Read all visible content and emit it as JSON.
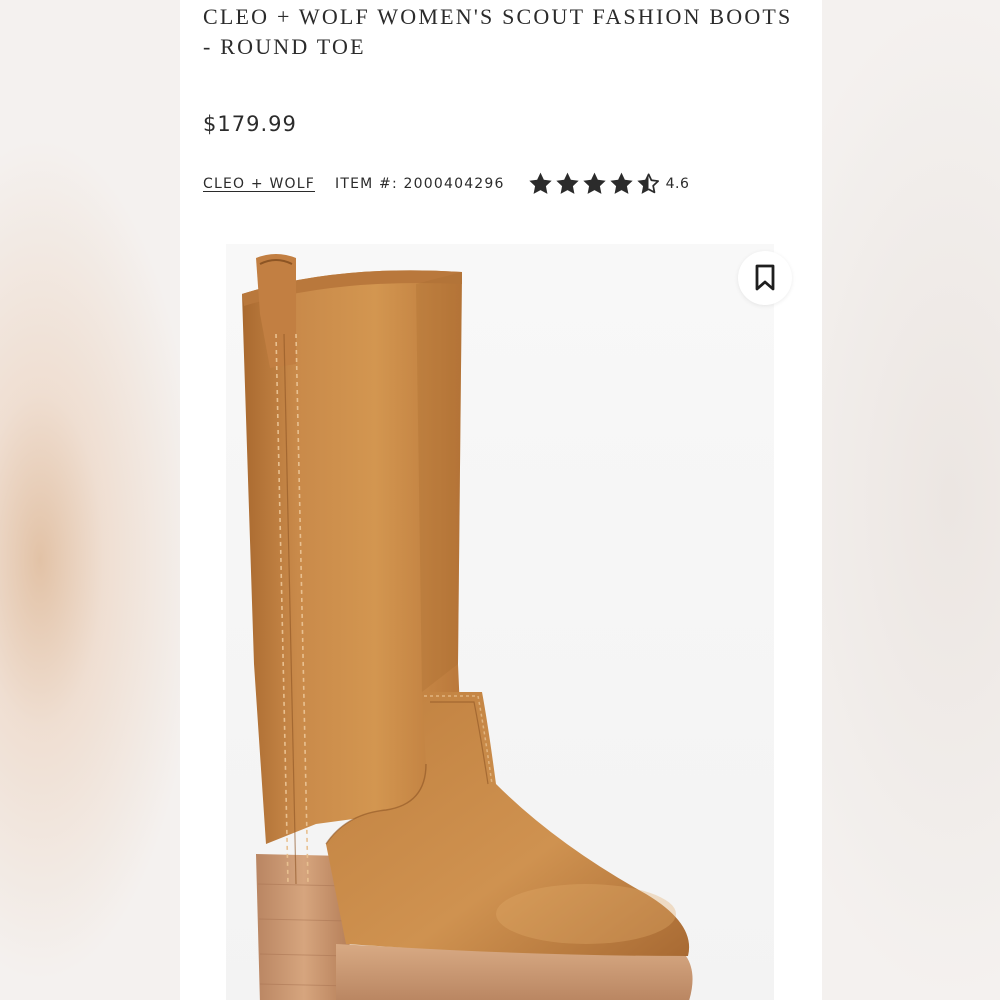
{
  "product": {
    "title": "CLEO + WOLF WOMEN'S SCOUT FASHION BOOTS - ROUND TOE",
    "price": "$179.99",
    "brand": "CLEO + WOLF",
    "item_number": "ITEM #: 2000404296",
    "rating": {
      "value": "4.6",
      "stars": 4.6,
      "max": 5
    }
  },
  "image": {
    "subject": "tan leather tall boot with stacked block heel",
    "colors": {
      "leather": "#c98a4a",
      "heel": "#c99a72",
      "background": "#f5f5f5"
    }
  },
  "icons": {
    "star": "star-icon",
    "half_star": "star-half-icon",
    "save": "bookmark-icon"
  },
  "colors": {
    "text": "#2b2b2b",
    "card_bg": "#ffffff",
    "page_bg": "#f4f1ef"
  }
}
